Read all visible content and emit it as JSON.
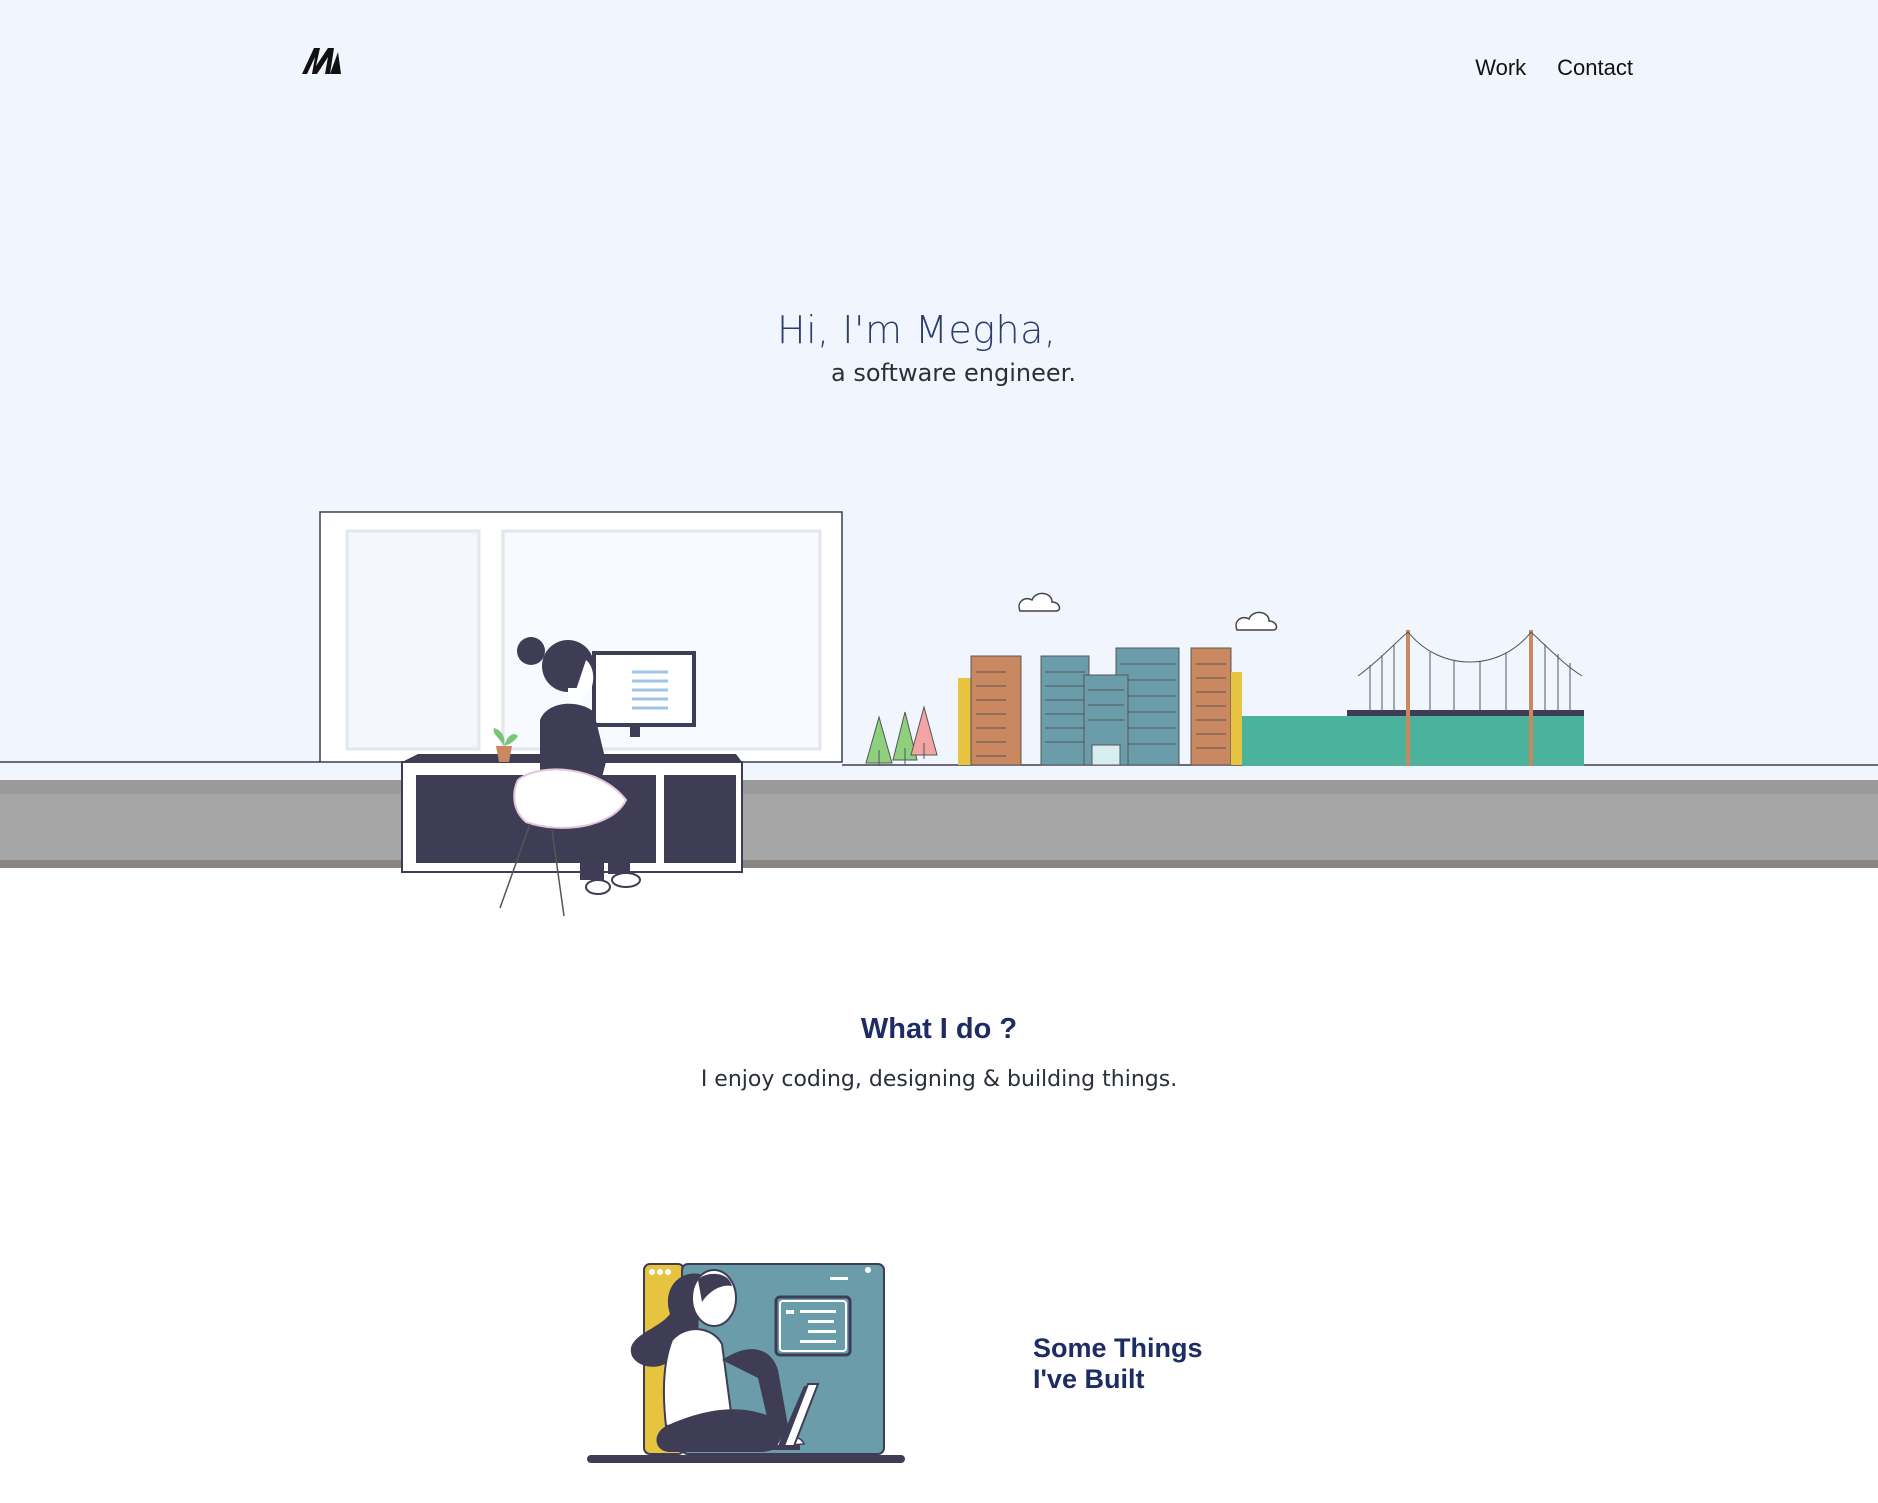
{
  "header": {
    "logo_text": "M",
    "nav": [
      {
        "label": "Work"
      },
      {
        "label": "Contact"
      }
    ]
  },
  "hero": {
    "title": "Hi, I'm Megha,",
    "subtitle": "a software engineer."
  },
  "what_i_do": {
    "title": "What I do ?",
    "text": "I enjoy coding, designing & building things."
  },
  "projects": {
    "title_line1": "Some Things",
    "title_line2": "I've Built"
  },
  "colors": {
    "hero_background": "#f1f6fe",
    "heading_blue": "#1d2c62",
    "hero_title_blue": "#2b3e6b",
    "desk_dark": "#3f3d56",
    "road_gray": "#a6a6a6",
    "water_teal": "#4bb39b",
    "building_orange": "#c98860",
    "building_blue": "#6a9ca9",
    "accent_yellow": "#e6c440"
  },
  "icons": [
    "logo-icon",
    "cloud-icon",
    "monitor-icon",
    "plant-icon",
    "tree-icon",
    "bridge-icon",
    "code-window-icon",
    "laptop-icon"
  ]
}
